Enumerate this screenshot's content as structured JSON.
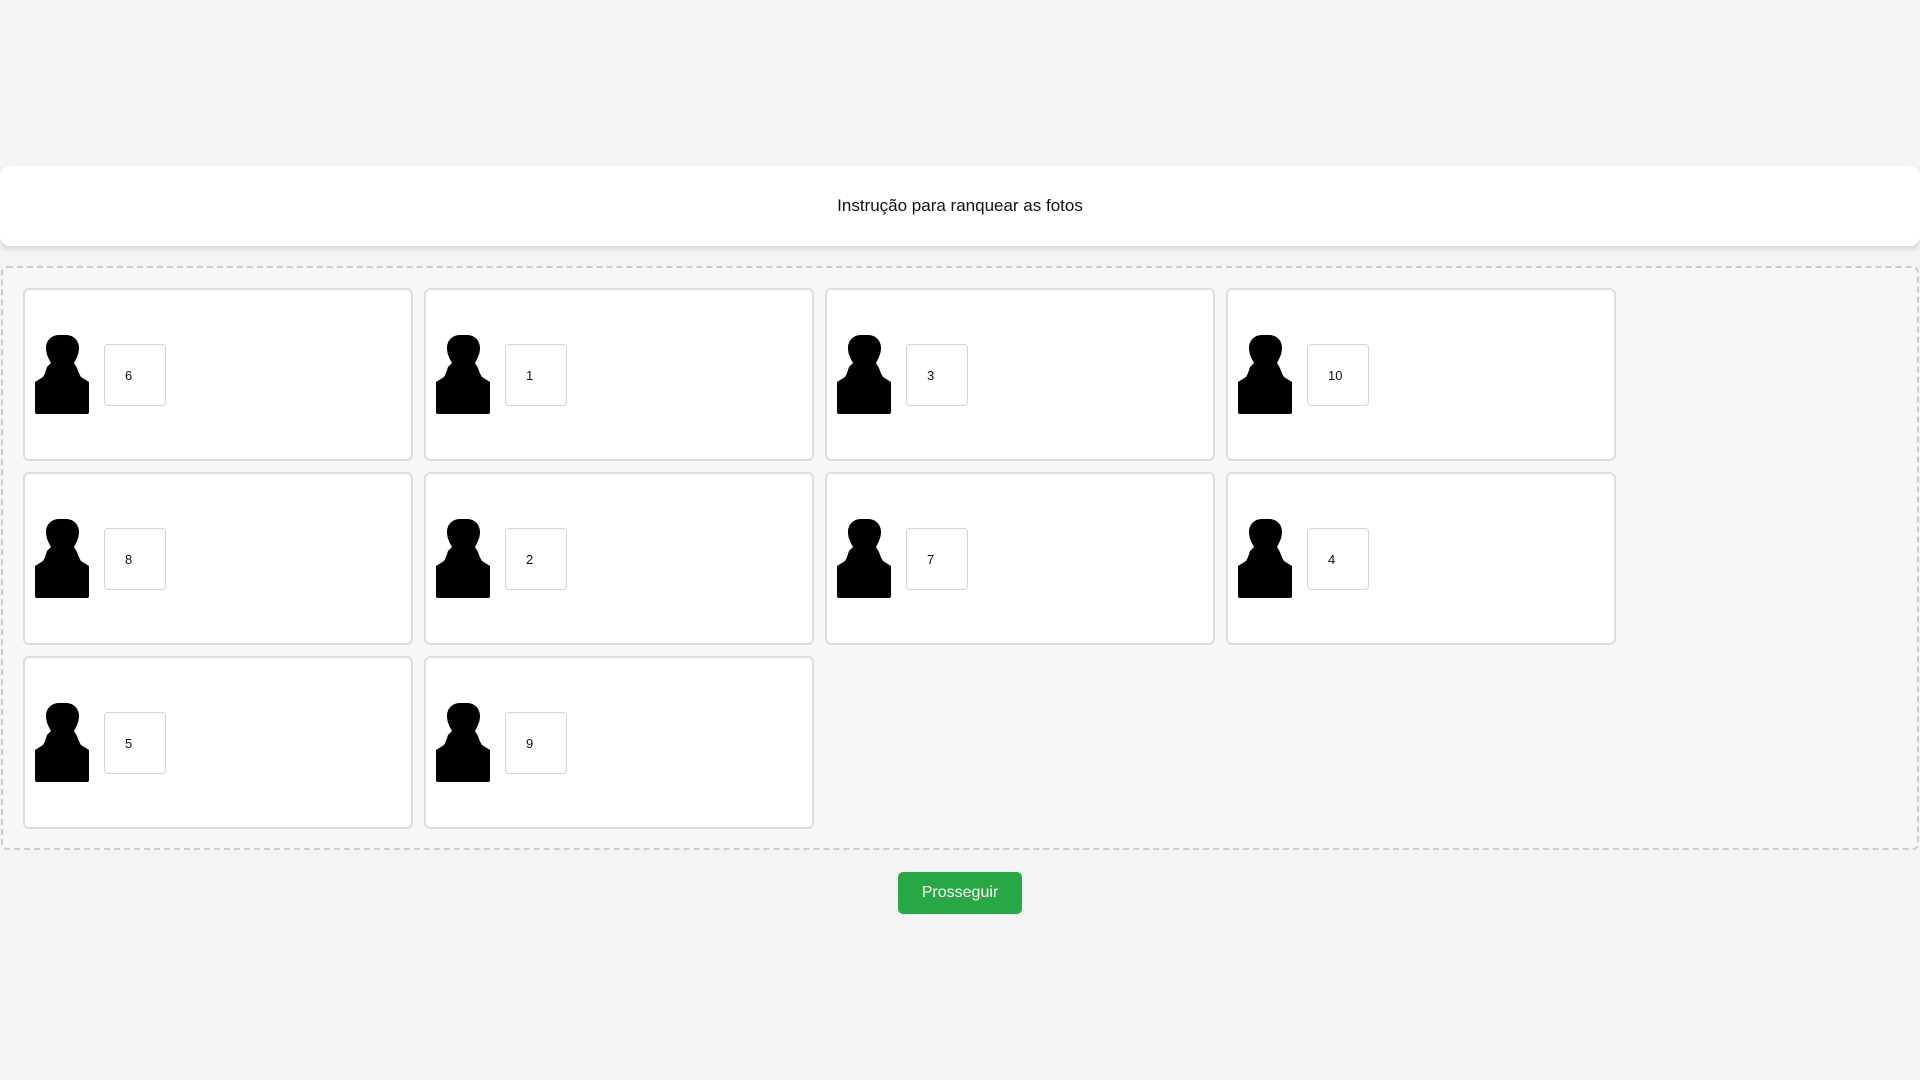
{
  "instruction": {
    "text": "Instrução para ranquear as fotos"
  },
  "photos": [
    {
      "icon": "person-silhouette-icon",
      "rank": "6"
    },
    {
      "icon": "person-silhouette-icon",
      "rank": "1"
    },
    {
      "icon": "person-silhouette-icon",
      "rank": "3"
    },
    {
      "icon": "person-silhouette-icon",
      "rank": "10"
    },
    {
      "icon": "person-silhouette-icon",
      "rank": "8"
    },
    {
      "icon": "person-silhouette-icon",
      "rank": "2"
    },
    {
      "icon": "person-silhouette-icon",
      "rank": "7"
    },
    {
      "icon": "person-silhouette-icon",
      "rank": "4"
    },
    {
      "icon": "person-silhouette-icon",
      "rank": "5"
    },
    {
      "icon": "person-silhouette-icon",
      "rank": "9"
    }
  ],
  "actions": {
    "continue_label": "Prosseguir"
  },
  "colors": {
    "page_background": "#f4f4f4",
    "button_background": "#28a745",
    "button_text": "#ffffff"
  }
}
